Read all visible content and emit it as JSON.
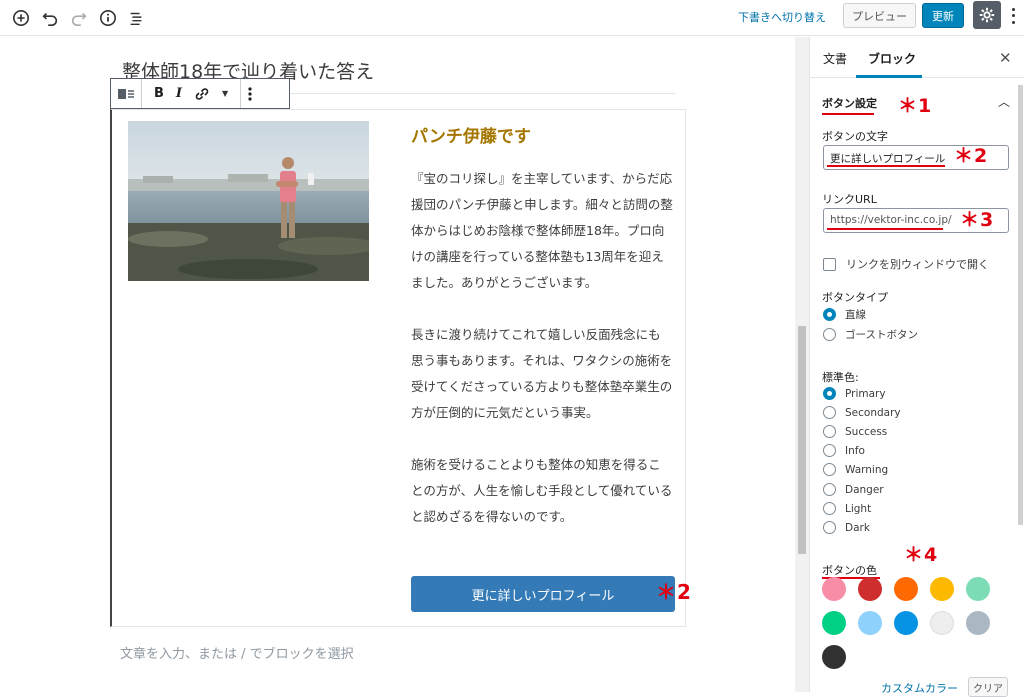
{
  "header": {
    "draft_link": "下書きへ切り替え",
    "preview": "プレビュー",
    "update": "更新"
  },
  "editor": {
    "heading": "整体師18年で辿り着いた答え",
    "profile_title": "パンチ伊藤です",
    "paragraphs": [
      "『宝のコリ探し』を主宰しています、からだ応援団のパンチ伊藤と申します。細々と訪問の整体からはじめお陰様で整体師歴18年。プロ向けの講座を行っている整体塾も13周年を迎えました。ありがとうございます。",
      "長きに渡り続けてこれて嬉しい反面残念にも思う事もあります。それは、ワタクシの施術を受けてくださっている方よりも整体塾卒業生の方が圧倒的に元気だという事実。",
      "施術を受けることよりも整体の知恵を得ることの方が、人生を愉しむ手段として優れていると認めざるを得ないのです。"
    ],
    "profile_button": "更に詳しいプロフィール",
    "paragraph_hint": "文章を入力、または / でブロックを選択"
  },
  "annotations": {
    "m1": "＊1",
    "m2a": "＊2",
    "m2b": "＊2",
    "m3": "＊3",
    "m4": "＊4"
  },
  "sidebar": {
    "tab_document": "文書",
    "tab_block": "ブロック",
    "panel_title": "ボタン設定",
    "button_text_label": "ボタンの文字",
    "button_text_value": "更に詳しいプロフィール",
    "link_url_label": "リンクURL",
    "link_url_value": "https://vektor-inc.co.jp/",
    "new_window_label": "リンクを別ウィンドウで開く",
    "button_type_label": "ボタンタイプ",
    "button_types": [
      "直線",
      "ゴーストボタン"
    ],
    "standard_color_label": "標準色:",
    "standard_colors": [
      "Primary",
      "Secondary",
      "Success",
      "Info",
      "Warning",
      "Danger",
      "Light",
      "Dark"
    ],
    "button_color_label": "ボタンの色",
    "swatches": [
      "#f78da7",
      "#cf2e2e",
      "#ff6900",
      "#fcb900",
      "#7bdcb5",
      "#00d084",
      "#8ed1fc",
      "#0693e3",
      "#eeeeee",
      "#abb8c3",
      "#313131"
    ],
    "custom_color": "カスタムカラー",
    "clear": "クリア"
  },
  "colors": {
    "accent": "#0085ba",
    "profile_button": "#337ab7",
    "title_gold": "#a47600",
    "annotation_red": "#e0000f"
  }
}
